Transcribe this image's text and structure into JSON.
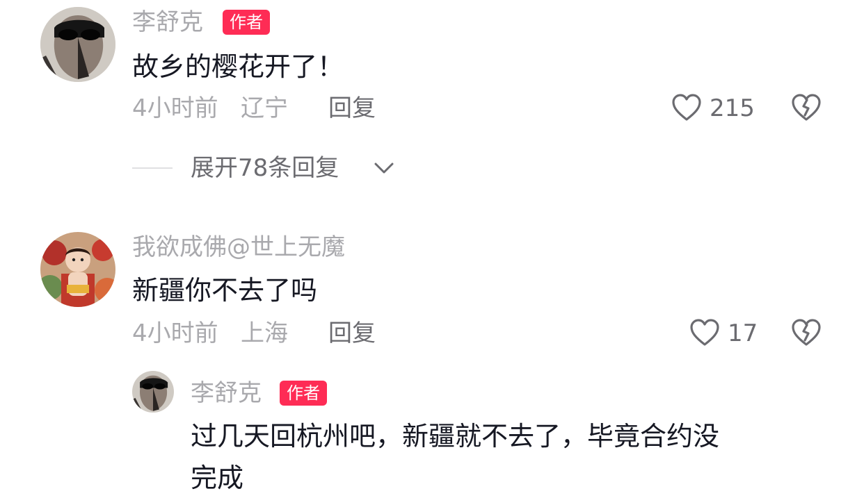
{
  "comments": [
    {
      "avatar_icon": "masked-face-avatar",
      "username": "李舒克",
      "badge": "作者",
      "content": "故乡的樱花开了！",
      "time": "4小时前",
      "location": "辽宁",
      "reply_label": "回复",
      "likes": "215",
      "expand_label": "展开78条回复"
    },
    {
      "avatar_icon": "baby-figure-avatar",
      "username": "我欲成佛@世上无魔",
      "content": "新疆你不去了吗",
      "time": "4小时前",
      "location": "上海",
      "reply_label": "回复",
      "likes": "17",
      "replies": [
        {
          "avatar_icon": "masked-face-avatar",
          "username": "李舒克",
          "badge": "作者",
          "content_line1": "过几天回杭州吧，新疆就不去了，毕竟合约没",
          "content_line2": "完成"
        }
      ]
    }
  ],
  "colors": {
    "badge": "#fe2c55",
    "text_primary": "#161823",
    "text_secondary": "#a9a9ad",
    "text_action": "#6b6b70"
  }
}
